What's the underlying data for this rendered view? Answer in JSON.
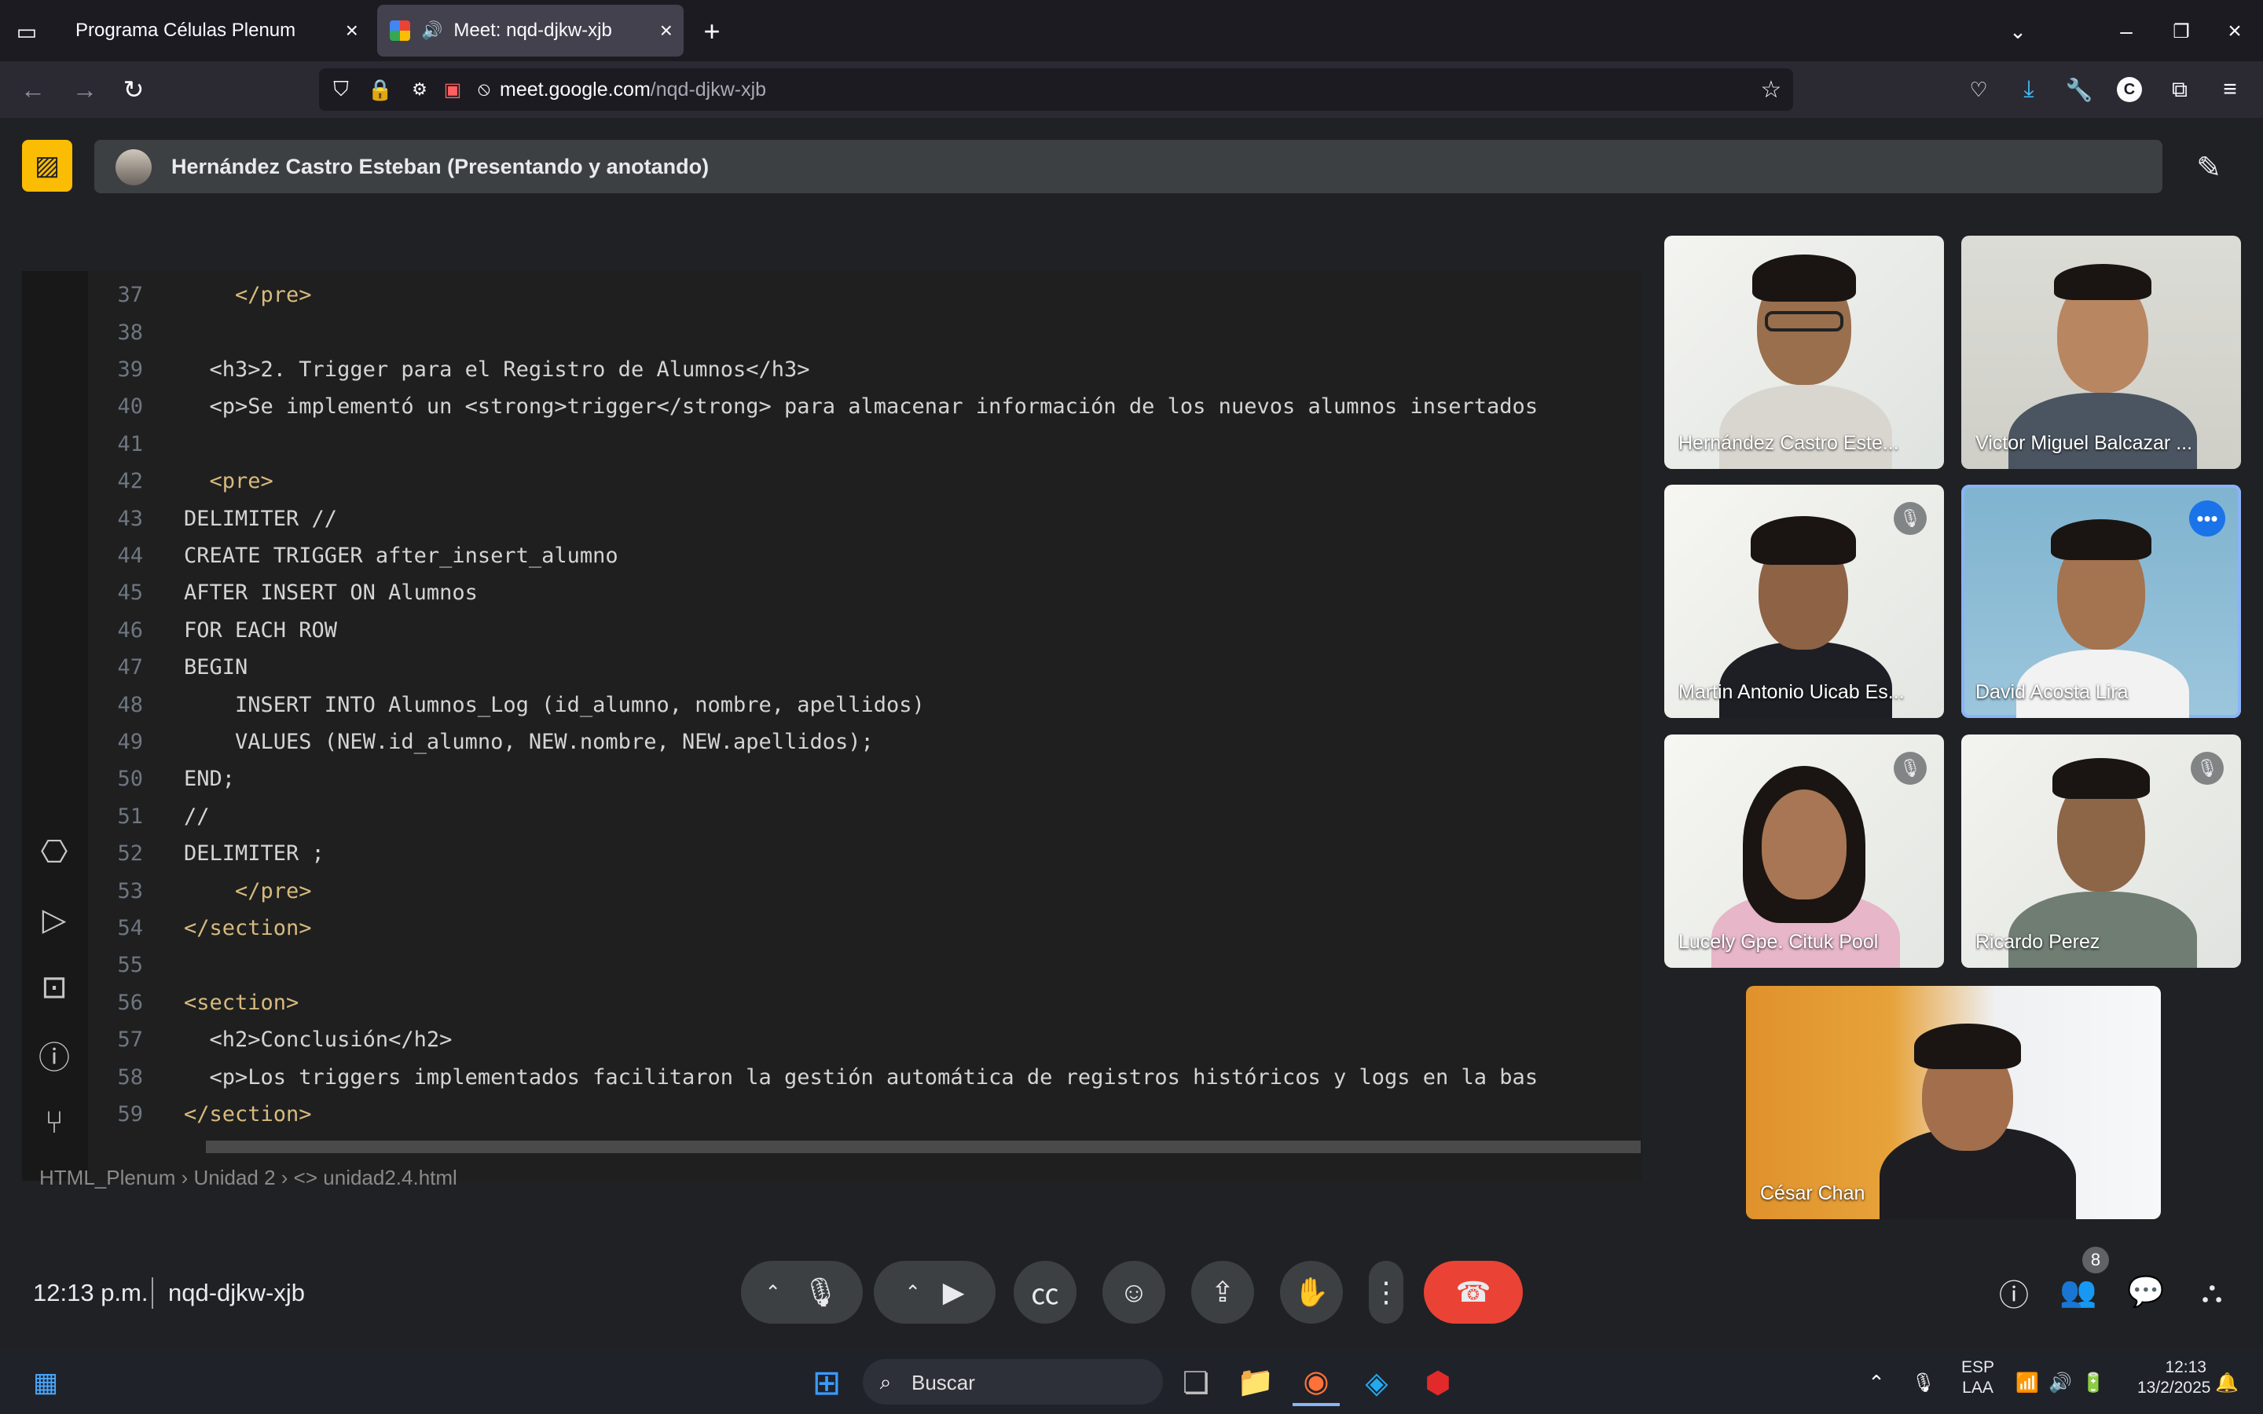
{
  "browser": {
    "tabs": [
      {
        "label": "Programa Células Plenum",
        "active": false
      },
      {
        "label": "Meet: nqd-djkw-xjb",
        "active": true
      }
    ],
    "new_tab_glyph": "+",
    "url_host": "meet.google.com",
    "url_path": "/nqd-djkw-xjb"
  },
  "presenter": {
    "banner": "Hernández Castro Esteban (Presentando y anotando)"
  },
  "editor": {
    "lines": [
      {
        "n": "37",
        "text": "    </pre>",
        "style": "tag-hl"
      },
      {
        "n": "38",
        "text": "",
        "style": "code"
      },
      {
        "n": "39",
        "text": "  <h3>2. Trigger para el Registro de Alumnos</h3>",
        "style": "code"
      },
      {
        "n": "40",
        "text": "  <p>Se implementó un <strong>trigger</strong> para almacenar información de los nuevos alumnos insertados",
        "style": "code"
      },
      {
        "n": "41",
        "text": "",
        "style": "code"
      },
      {
        "n": "42",
        "text": "  <pre>",
        "style": "tag"
      },
      {
        "n": "43",
        "text": "DELIMITER //",
        "style": "code"
      },
      {
        "n": "44",
        "text": "CREATE TRIGGER after_insert_alumno",
        "style": "code"
      },
      {
        "n": "45",
        "text": "AFTER INSERT ON Alumnos",
        "style": "code"
      },
      {
        "n": "46",
        "text": "FOR EACH ROW",
        "style": "code"
      },
      {
        "n": "47",
        "text": "BEGIN",
        "style": "code"
      },
      {
        "n": "48",
        "text": "    INSERT INTO Alumnos_Log (id_alumno, nombre, apellidos)",
        "style": "code"
      },
      {
        "n": "49",
        "text": "    VALUES (NEW.id_alumno, NEW.nombre, NEW.apellidos);",
        "style": "code"
      },
      {
        "n": "50",
        "text": "END;",
        "style": "code"
      },
      {
        "n": "51",
        "text": "//",
        "style": "code"
      },
      {
        "n": "52",
        "text": "DELIMITER ;",
        "style": "code"
      },
      {
        "n": "53",
        "text": "    </pre>",
        "style": "tag"
      },
      {
        "n": "54",
        "text": "</section>",
        "style": "tag"
      },
      {
        "n": "55",
        "text": "",
        "style": "code"
      },
      {
        "n": "56",
        "text": "<section>",
        "style": "tag"
      },
      {
        "n": "57",
        "text": "  <h2>Conclusión</h2>",
        "style": "code"
      },
      {
        "n": "58",
        "text": "  <p>Los triggers implementados facilitaron la gestión automática de registros históricos y logs en la bas",
        "style": "code"
      },
      {
        "n": "59",
        "text": "</section>",
        "style": "tag"
      }
    ],
    "breadcrumb": "HTML_Plenum  ›  Unidad 2  ›  <> unidad2.4.html"
  },
  "participants": [
    {
      "name": "Hernández Castro Este...",
      "muted": false
    },
    {
      "name": "Victor Miguel Balcazar ...",
      "muted": false
    },
    {
      "name": "Martin Antonio Uicab Es...",
      "muted": true
    },
    {
      "name": "David Acosta Lira",
      "muted": false,
      "speaking": true
    },
    {
      "name": "Lucely Gpe. Cituk Pool",
      "muted": true
    },
    {
      "name": "Ricardo Perez",
      "muted": true
    },
    {
      "name": "César Chan",
      "muted": false
    }
  ],
  "meeting": {
    "time": "12:13 p.m.",
    "code": "nqd-djkw-xjb",
    "people_count": "8"
  },
  "taskbar": {
    "search_placeholder": "Buscar",
    "lang_line1": "ESP",
    "lang_line2": "LAA",
    "clock_time": "12:13",
    "clock_date": "13/2/2025"
  },
  "colors": {
    "accent": "#fbbc04",
    "hangup": "#ea4335",
    "speaking_border": "#8ab4f8"
  }
}
